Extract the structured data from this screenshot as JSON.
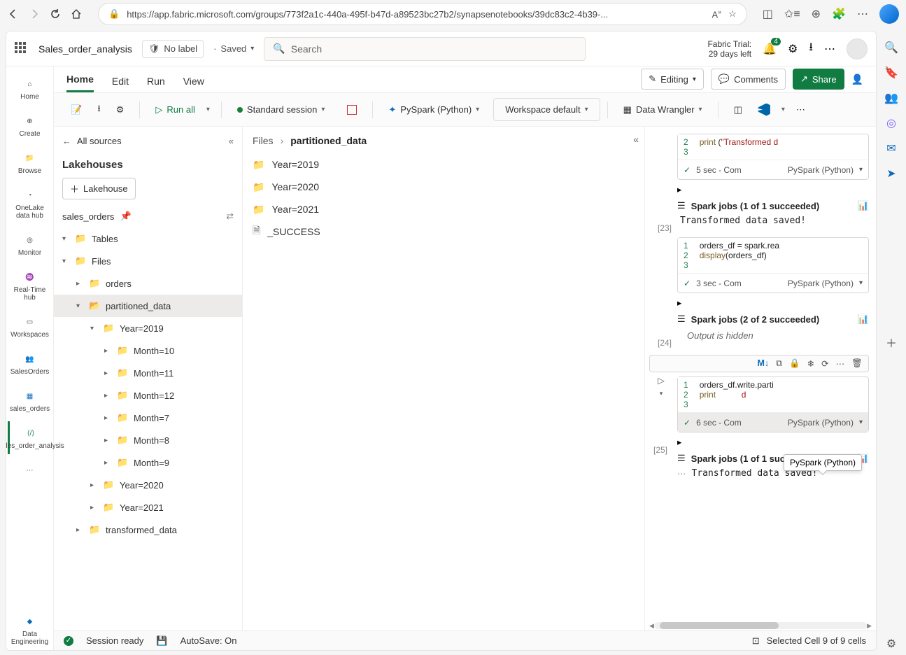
{
  "browser": {
    "url": "https://app.fabric.microsoft.com/groups/773f2a1c-440a-495f-b47d-a89523bc27b2/synapsenotebooks/39dc83c2-4b39-..."
  },
  "titleBar": {
    "notebook": "Sales_order_analysis",
    "label": "No label",
    "saved": "Saved",
    "searchPlaceholder": "Search",
    "trialLine1": "Fabric Trial:",
    "trialLine2": "29 days left",
    "notif": "4"
  },
  "tabs": {
    "home": "Home",
    "edit": "Edit",
    "run": "Run",
    "view": "View",
    "editing": "Editing",
    "comments": "Comments",
    "share": "Share"
  },
  "toolbar": {
    "runAll": "Run all",
    "session": "Standard session",
    "lang": "PySpark (Python)",
    "workspace": "Workspace default",
    "wrangler": "Data Wrangler"
  },
  "leftNav": {
    "home": "Home",
    "create": "Create",
    "browse": "Browse",
    "onelake": "OneLake data hub",
    "monitor": "Monitor",
    "realtime": "Real-Time hub",
    "workspaces": "Workspaces",
    "salesOrdersWs": "SalesOrders",
    "salesOrdersLh": "sales_orders",
    "nb": "Sales_order_analysis",
    "dataeng": "Data Engineering"
  },
  "explorer": {
    "back": "All sources",
    "panel": "Lakehouses",
    "addBtn": "Lakehouse",
    "dsName": "sales_orders",
    "tables": "Tables",
    "files": "Files",
    "orders": "orders",
    "partitioned": "partitioned_data",
    "y19": "Year=2019",
    "m10": "Month=10",
    "m11": "Month=11",
    "m12": "Month=12",
    "m7": "Month=7",
    "m8": "Month=8",
    "m9": "Month=9",
    "y20": "Year=2020",
    "y21": "Year=2021",
    "transformed": "transformed_data"
  },
  "filePane": {
    "crumb1": "Files",
    "crumb2": "partitioned_data",
    "rows": [
      "Year=2019",
      "Year=2020",
      "Year=2021",
      "_SUCCESS"
    ]
  },
  "nb": {
    "c23num": "[23]",
    "c23l1": "print (\"Transformed d",
    "c23foot": "5 sec - Com",
    "c23lang": "PySpark (Python)",
    "jobs1": "Spark jobs (1 of 1 succeeded)",
    "out1": "Transformed data saved!",
    "c24num": "[24]",
    "c24l1": "orders_df = spark.rea",
    "c24l2": "display(orders_df)",
    "c24foot": "3 sec - Com",
    "jobs2": "Spark jobs (2 of 2 succeeded)",
    "hidden": "Output is hidden",
    "c25num": "[25]",
    "c25l1": "orders_df.write.parti",
    "c25l2": "print (\"",
    "c25l2b": "d",
    "c25foot": "6 sec - Com",
    "jobs3": "Spark jobs (1 of 1 succeeded)",
    "out3": "Transformed data saved!",
    "tooltip": "PySpark (Python)"
  },
  "status": {
    "ready": "Session ready",
    "autosave": "AutoSave: On",
    "cell": "Selected Cell 9 of 9 cells"
  }
}
